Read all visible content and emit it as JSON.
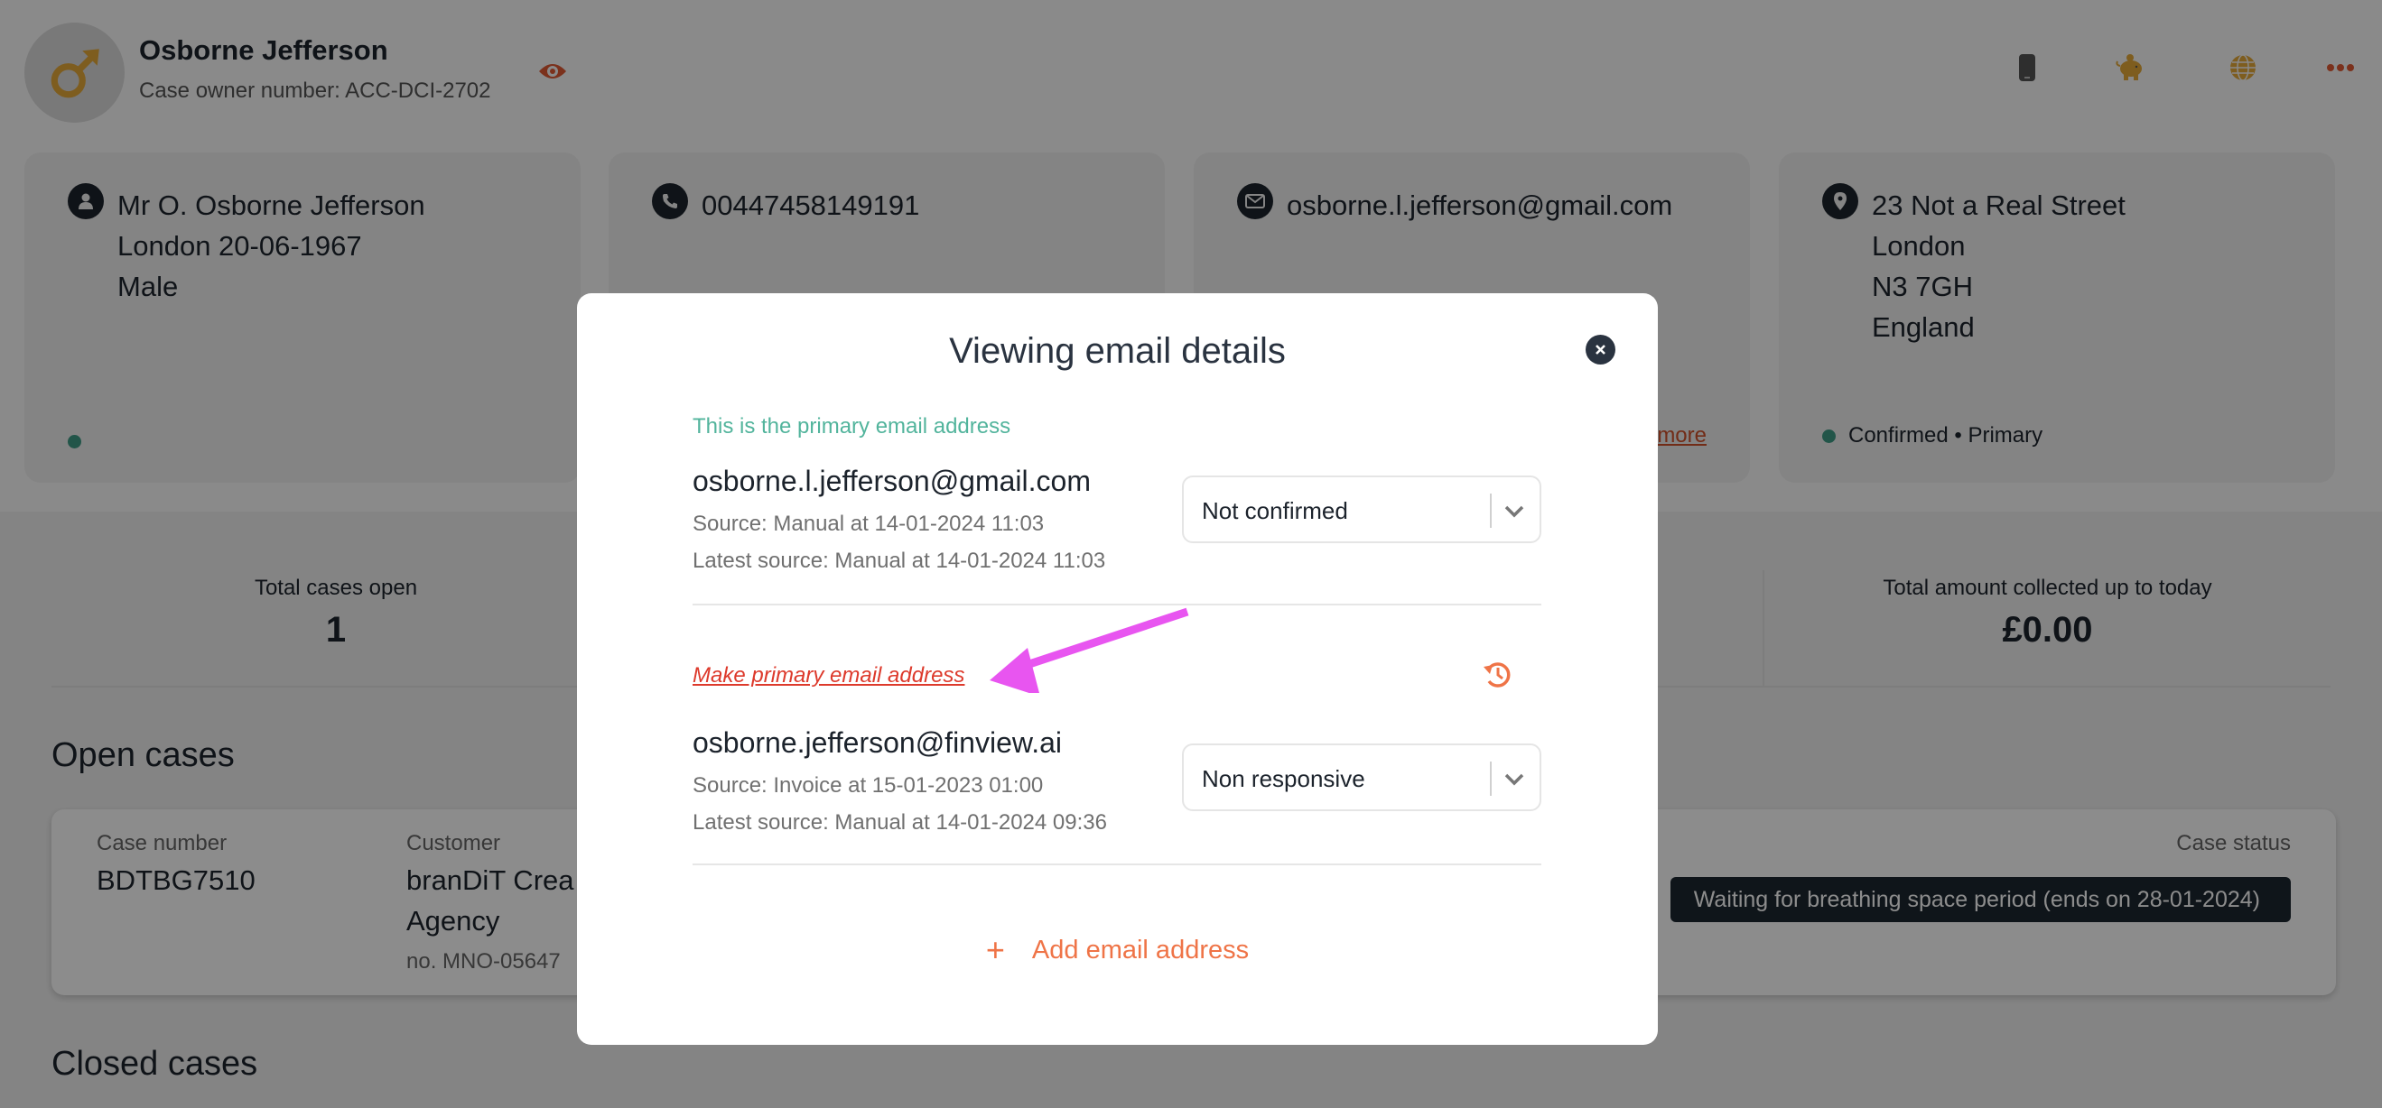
{
  "header": {
    "owner_name": "Osborne Jefferson",
    "owner_number": "Case owner number: ACC-DCI-2702",
    "icons": [
      "mobile-icon",
      "piggy-bank-icon",
      "globe-icon",
      "more-icon",
      "chevron-up-icon"
    ]
  },
  "cards": {
    "person": {
      "lines": [
        "Mr O. Osborne Jefferson",
        "London 20-06-1967",
        "Male"
      ]
    },
    "phone": {
      "number": "00447458149191"
    },
    "email": {
      "address": "osborne.l.jefferson@gmail.com",
      "more_link": "more"
    },
    "address": {
      "lines": [
        "23 Not a Real Street",
        "London",
        "N3 7GH",
        "England"
      ],
      "status": "Confirmed • Primary"
    }
  },
  "stats": {
    "total_open_label": "Total cases open",
    "total_open_value": "1",
    "total_collected_label": "Total amount collected up to today",
    "total_collected_value": "£0.00"
  },
  "sections": {
    "open_cases": "Open cases",
    "closed_cases": "Closed cases"
  },
  "case": {
    "case_number_label": "Case number",
    "case_number": "BDTBG7510",
    "customer_label": "Customer",
    "customer_line1": "branDiT Crea",
    "customer_line2": "Agency",
    "customer_no": "no.  MNO-05647",
    "case_status_label": "Case status",
    "case_status": "Waiting for breathing space period (ends on 28-01-2024)"
  },
  "modal": {
    "title": "Viewing email details",
    "primary_note": "This is the primary email address",
    "emails": [
      {
        "address": "osborne.l.jefferson@gmail.com",
        "source": "Source: Manual at 14-01-2024 11:03",
        "latest_source": "Latest source: Manual at 14-01-2024 11:03",
        "status": "Not confirmed"
      },
      {
        "address": "osborne.jefferson@finview.ai",
        "source": "Source: Invoice at 15-01-2023 01:00",
        "latest_source": "Latest source: Manual at 14-01-2024 09:36",
        "status": "Non responsive",
        "make_primary_label": "Make primary email address"
      }
    ],
    "add_email_label": "Add email address",
    "add_icon": "+"
  },
  "colors": {
    "accent": "#ef7447",
    "primary_note": "#52b49c",
    "make_primary": "#dd3a2c",
    "annotation": "#e855f0",
    "badge_bg": "#1c2730"
  }
}
